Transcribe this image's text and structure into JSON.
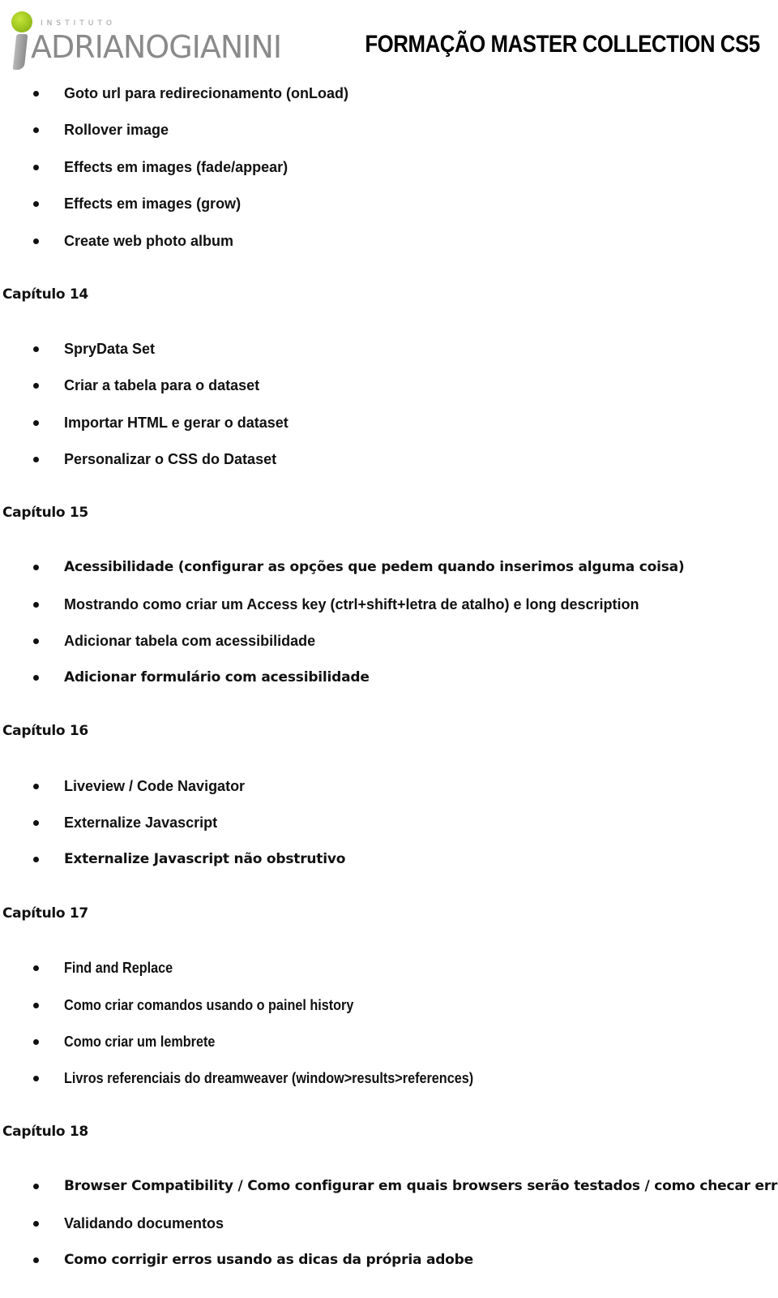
{
  "header": {
    "logo": {
      "prefix": "INSTITUTO",
      "name": "ADRIANOGIANINI",
      "accent_color": "#9cc51e",
      "text_color": "#8a8a8a"
    },
    "title": "FORMAÇÃO MASTER COLLECTION CS5"
  },
  "sections": [
    {
      "chapter": "",
      "items": [
        "Goto url para redirecionamento (onLoad)",
        "Rollover image",
        "Effects em images (fade/appear)",
        "Effects em images (grow)",
        "Create web photo album"
      ]
    },
    {
      "chapter": "Capítulo 14",
      "items": [
        "SpryData Set",
        "Criar a tabela para o dataset",
        "Importar HTML e gerar o dataset",
        "Personalizar o CSS do Dataset"
      ]
    },
    {
      "chapter": "Capítulo 15",
      "items": [
        "Acessibilidade (configurar as opções que pedem quando inserimos alguma coisa)",
        "Mostrando como criar um Access key (ctrl+shift+letra de atalho) e long description",
        "Adicionar tabela com acessibilidade",
        "Adicionar formulário com acessibilidade"
      ]
    },
    {
      "chapter": "Capítulo 16",
      "items": [
        "Liveview / Code Navigator",
        "Externalize Javascript",
        "Externalize Javascript não obstrutivo"
      ]
    },
    {
      "chapter": "Capítulo 17",
      "items": [
        "Find and Replace",
        "Como criar comandos usando o painel history",
        "Como criar um lembrete",
        "Livros referenciais do dreamweaver (window>results>references)"
      ]
    },
    {
      "chapter": "Capítulo 18",
      "items": [
        "Browser Compatibility / Como configurar em quais browsers serão testados / como checar erros",
        "Validando documentos",
        "Como corrigir erros usando as dicas da própria adobe"
      ]
    }
  ]
}
